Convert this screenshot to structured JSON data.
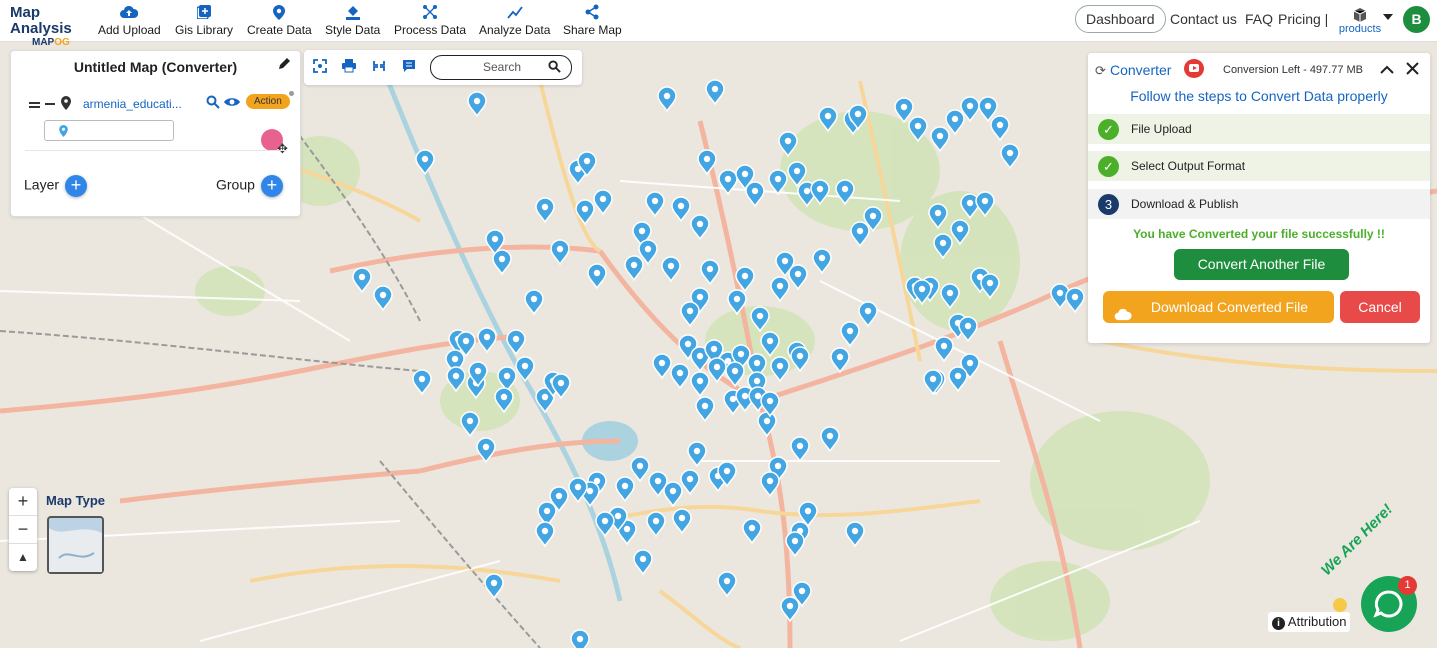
{
  "brand": {
    "line1": "Map Analysis",
    "line2a": "MAP",
    "line2b": "OG"
  },
  "nav": [
    {
      "label": "Add Upload",
      "icon": "cloud-upload-icon"
    },
    {
      "label": "Gis Library",
      "icon": "library-icon"
    },
    {
      "label": "Create Data",
      "icon": "location-pin-icon"
    },
    {
      "label": "Style Data",
      "icon": "paint-bucket-icon"
    },
    {
      "label": "Process Data",
      "icon": "process-icon"
    },
    {
      "label": "Analyze Data",
      "icon": "analyze-icon"
    },
    {
      "label": "Share Map",
      "icon": "share-icon"
    }
  ],
  "top_right": {
    "dashboard": "Dashboard",
    "contact": "Contact us",
    "faq": "FAQ",
    "pricing": "Pricing |",
    "products": "products",
    "avatar": "B"
  },
  "layer_panel": {
    "title": "Untitled Map (Converter)",
    "layer_name": "armenia_educati...",
    "action": "Action",
    "layer_label": "Layer",
    "group_label": "Group"
  },
  "toolbar": {
    "search_placeholder": "Search"
  },
  "converter": {
    "title": "Converter",
    "conversion_left": "Conversion Left - 497.77 MB",
    "instruction": "Follow the steps to Convert Data properly",
    "steps": [
      {
        "label": "File Upload",
        "state": "done"
      },
      {
        "label": "Select Output Format",
        "state": "done"
      },
      {
        "number": "3",
        "label": "Download & Publish",
        "state": "current"
      }
    ],
    "success_message": "You have Converted your file successfully !!",
    "convert_another": "Convert Another File",
    "download": "Download Converted File",
    "cancel": "Cancel"
  },
  "map_controls": {
    "zoom_in": "+",
    "zoom_out": "−",
    "reset_north": "▲",
    "map_type": "Map Type"
  },
  "attribution": "Attribution",
  "chat": {
    "badge": "1",
    "banner": "We Are Here!"
  },
  "colors": {
    "brand_blue": "#1565c0",
    "accent_orange": "#f2a41f",
    "success_green": "#1e8e3e",
    "cancel_red": "#e84a4a",
    "marker_blue": "#43a6e2"
  }
}
